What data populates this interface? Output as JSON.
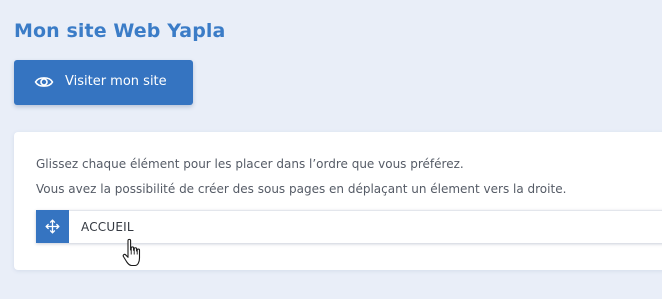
{
  "header": {
    "title": "Mon site Web Yapla"
  },
  "visit_button": {
    "label": "Visiter mon site",
    "icon": "eye-icon"
  },
  "card": {
    "instruction_1": "Glissez chaque élément pour les placer dans l’ordre que vous préférez.",
    "instruction_2": "Vous avez la possibilité de créer des sous pages en déplaçant un élement vers la droite.",
    "pages": [
      {
        "label": "ACCUEIL",
        "icon": "move-icon"
      }
    ]
  },
  "colors": {
    "accent": "#3574c1",
    "title": "#3b7cc7",
    "background": "#e9eef8"
  }
}
